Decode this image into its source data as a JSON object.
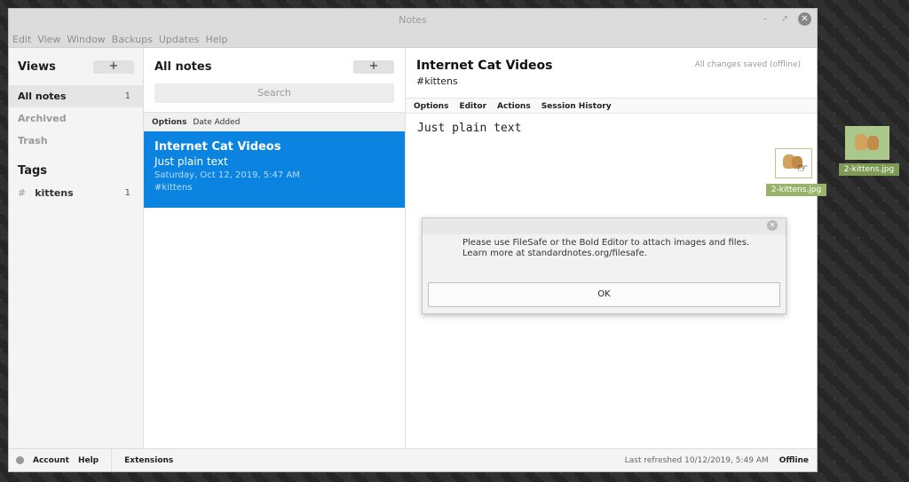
{
  "window": {
    "title": "Notes"
  },
  "menubar": [
    "Edit",
    "View",
    "Window",
    "Backups",
    "Updates",
    "Help"
  ],
  "views": {
    "title": "Views",
    "add_label": "+",
    "items": [
      {
        "label": "All notes",
        "count": "1"
      },
      {
        "label": "Archived",
        "count": ""
      },
      {
        "label": "Trash",
        "count": ""
      }
    ]
  },
  "tags": {
    "title": "Tags",
    "items": [
      {
        "hash": "#",
        "label": "kittens",
        "count": "1"
      }
    ]
  },
  "notes": {
    "title": "All notes",
    "add_label": "+",
    "search_placeholder": "Search",
    "sort": {
      "options_label": "Options",
      "value": "Date Added"
    },
    "items": [
      {
        "title": "Internet Cat Videos",
        "preview": "Just plain text",
        "date": "Saturday, Oct 12, 2019, 5:47 AM",
        "tags": "#kittens"
      }
    ]
  },
  "editor": {
    "title": "Internet Cat Videos",
    "tags": "#kittens",
    "save_status": "All changes saved (offline)",
    "menu": [
      "Options",
      "Editor",
      "Actions",
      "Session History"
    ],
    "body": "Just plain text"
  },
  "dialog": {
    "line1": "Please use FileSafe or the Bold Editor to attach images and files.",
    "line2": "Learn more at standardnotes.org/filesafe.",
    "ok_label": "OK"
  },
  "statusbar": {
    "account": "Account",
    "help": "Help",
    "extensions": "Extensions",
    "refreshed": "Last refreshed 10/12/2019, 5:49 AM",
    "offline": "Offline"
  },
  "drag": {
    "file_label": "2-kittens.jpg"
  },
  "desktop": {
    "file_label": "2-kittens.jpg"
  }
}
